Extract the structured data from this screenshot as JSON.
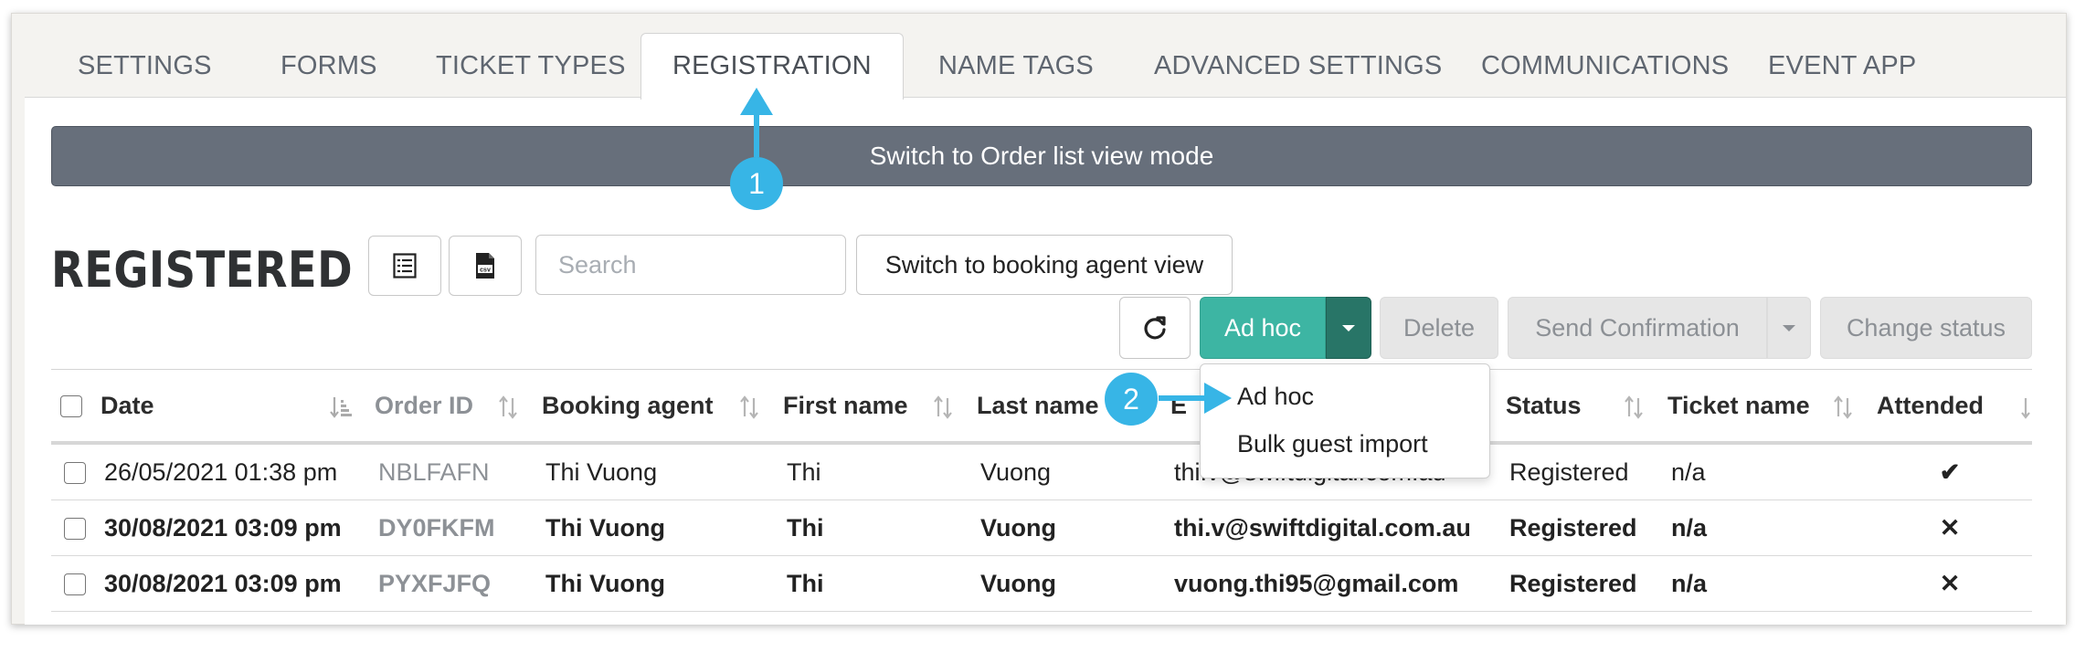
{
  "tabs": [
    {
      "label": "SETTINGS"
    },
    {
      "label": "FORMS"
    },
    {
      "label": "TICKET TYPES"
    },
    {
      "label": "REGISTRATION",
      "active": true
    },
    {
      "label": "NAME TAGS"
    },
    {
      "label": "ADVANCED SETTINGS"
    },
    {
      "label": "COMMUNICATIONS"
    },
    {
      "label": "EVENT APP"
    }
  ],
  "order_bar": {
    "label": "Switch to Order list view mode"
  },
  "section": {
    "title": "REGISTERED"
  },
  "toolbar": {
    "list_icon": "list-icon",
    "csv_icon": "csv-file-icon",
    "search_placeholder": "Search",
    "booking_agent_label": "Switch to booking agent view",
    "refresh_icon": "refresh-icon",
    "adhoc_label": "Ad hoc",
    "delete_label": "Delete",
    "send_confirmation_label": "Send Confirmation",
    "change_status_label": "Change status"
  },
  "dropdown": {
    "items": [
      "Ad hoc",
      "Bulk guest import"
    ]
  },
  "table": {
    "columns": [
      "Date",
      "Order ID",
      "Booking agent",
      "First name",
      "Last name",
      "E",
      "Status",
      "Ticket name",
      "Attended"
    ],
    "rows": [
      {
        "date": "26/05/2021 01:38 pm",
        "order_id": "NBLFAFN",
        "agent": "Thi Vuong",
        "first": "Thi",
        "last": "Vuong",
        "email": "thi.v@swiftdigital.com.au",
        "status": "Registered",
        "ticket": "n/a",
        "attended": "✔"
      },
      {
        "date": "30/08/2021 03:09 pm",
        "order_id": "DY0FKFM",
        "agent": "Thi Vuong",
        "first": "Thi",
        "last": "Vuong",
        "email": "thi.v@swiftdigital.com.au",
        "status": "Registered",
        "ticket": "n/a",
        "attended": "✕"
      },
      {
        "date": "30/08/2021 03:09 pm",
        "order_id": "PYXFJFQ",
        "agent": "Thi Vuong",
        "first": "Thi",
        "last": "Vuong",
        "email": "vuong.thi95@gmail.com",
        "status": "Registered",
        "ticket": "n/a",
        "attended": "✕"
      }
    ]
  },
  "annotations": [
    {
      "number": "1"
    },
    {
      "number": "2"
    }
  ],
  "colors": {
    "accent_teal": "#3db5a3",
    "badge_blue": "#37b5e6",
    "bar_grey": "#676f7b"
  }
}
